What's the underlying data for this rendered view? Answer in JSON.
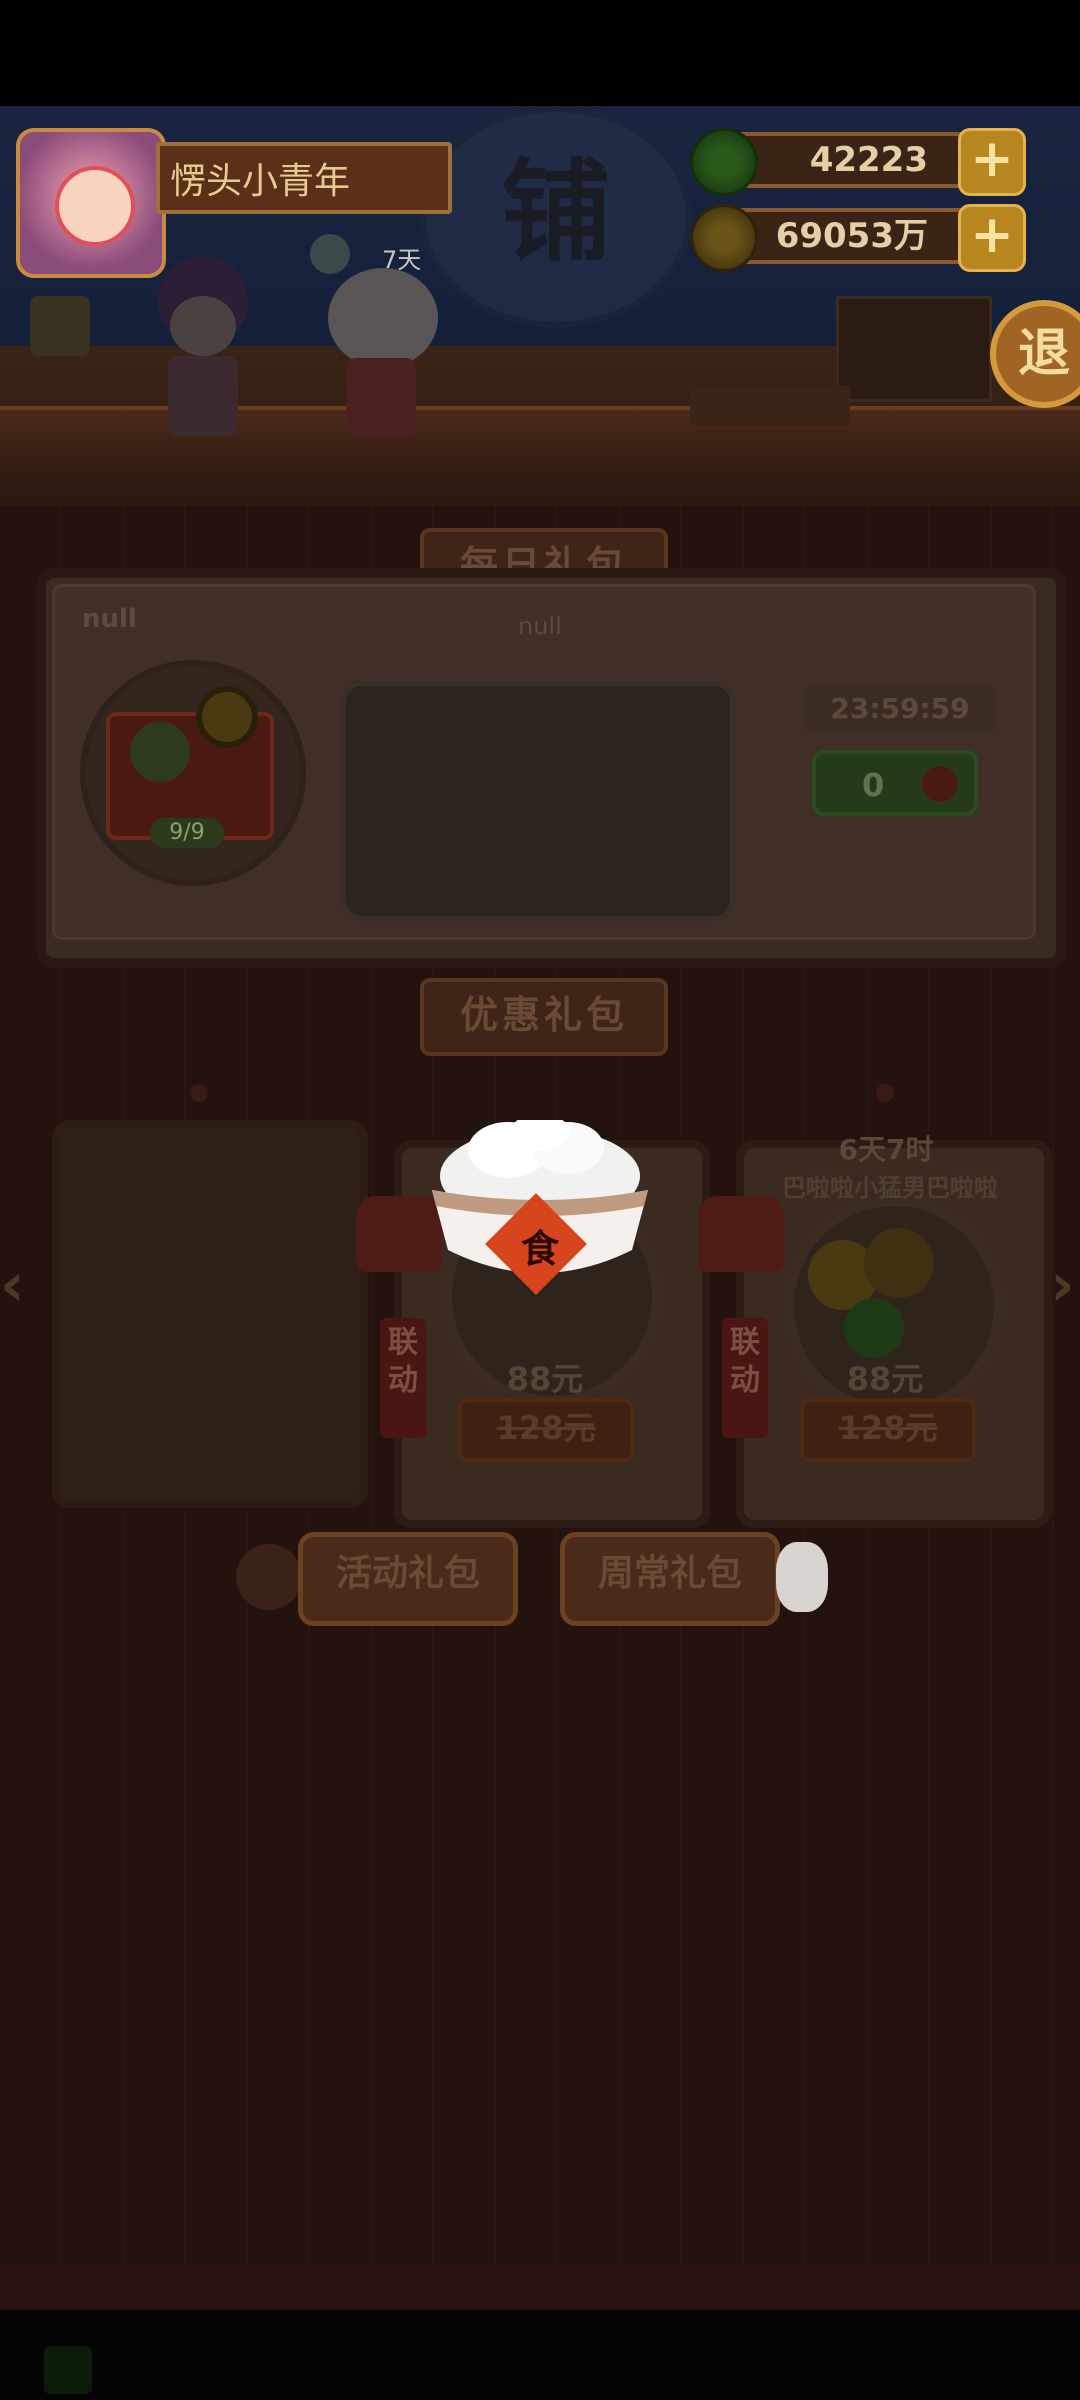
{
  "player": {
    "name": "愣头小青年"
  },
  "resources": [
    {
      "icon": "green-jade-coin-icon",
      "value": "42223"
    },
    {
      "icon": "gold-coin-icon",
      "value": "69053万"
    }
  ],
  "companion": {
    "days": "7天"
  },
  "header": {
    "banner_glyph": "铺"
  },
  "exit_button": {
    "label": "退"
  },
  "daily_gift": {
    "title": "每日礼包",
    "name": "null",
    "subtitle": "null",
    "chest_count": "9/9",
    "countdown": "23:59:59",
    "price_value": "0"
  },
  "discount_gift": {
    "title": "优惠礼包",
    "cards": [
      {
        "empty": true
      },
      {
        "tag": "联动",
        "price": "88元",
        "original_price": "128元"
      },
      {
        "timer": "6天7时",
        "name": "巴啦啦小猛男巴啦啦",
        "tag": "联动",
        "price": "88元",
        "original_price": "128元"
      }
    ]
  },
  "popup_bowl": {
    "label": "食"
  },
  "tabs": {
    "activity": "活动礼包",
    "regular": "周常礼包"
  },
  "colors": {
    "overlay": "#000000",
    "accent_gold": "#c98b3f",
    "green": "#2d4a1f"
  }
}
